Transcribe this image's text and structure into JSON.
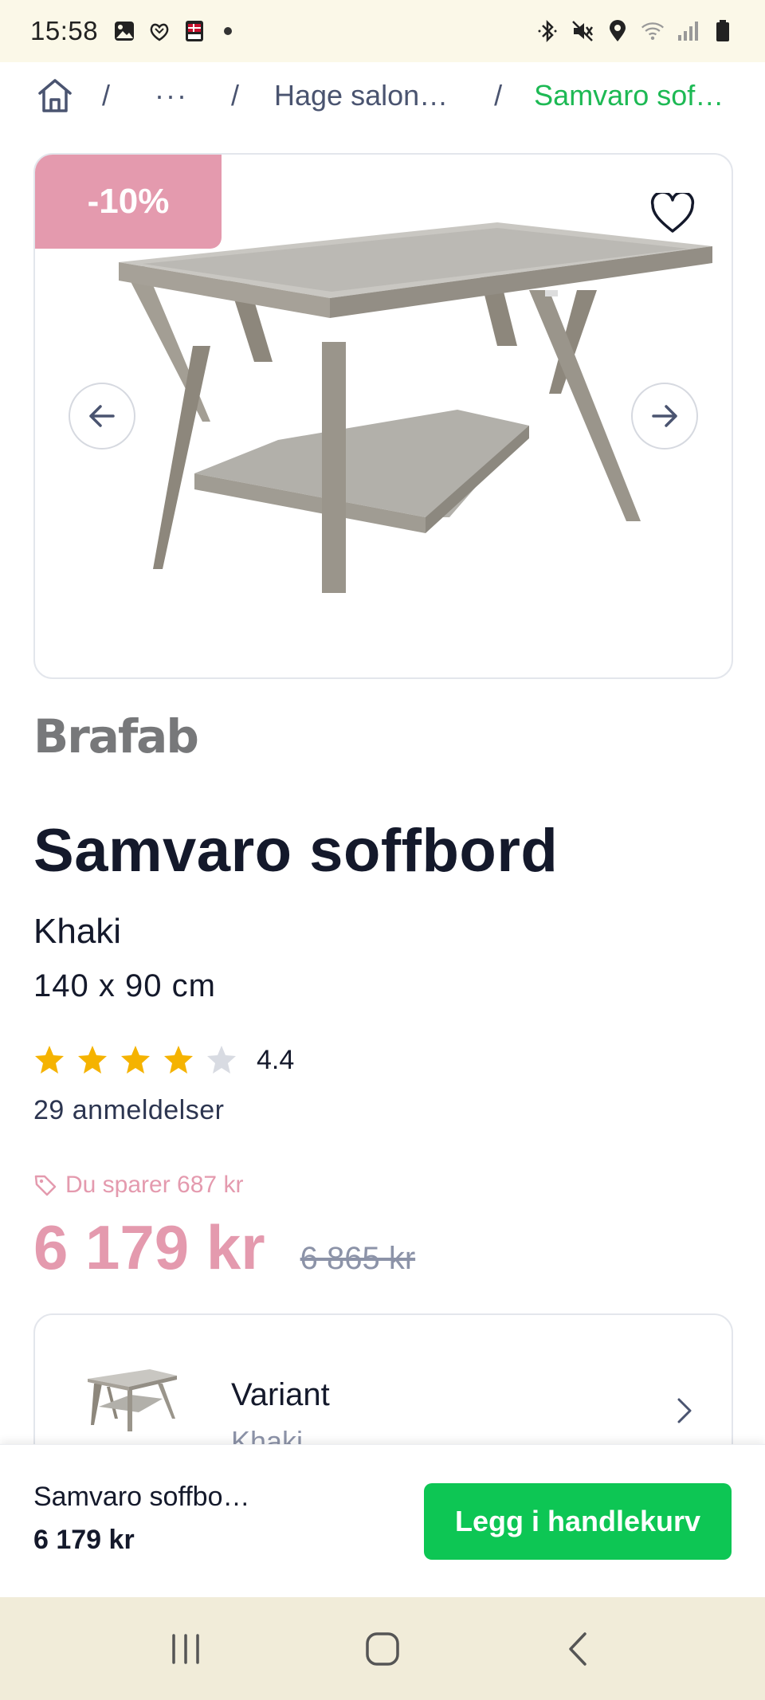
{
  "status_bar": {
    "time": "15:58",
    "left_icons": [
      "gallery-icon",
      "hands-icon",
      "flag-app-icon",
      "dot-icon"
    ],
    "right_icons": [
      "bluetooth-icon",
      "mute-icon",
      "location-icon",
      "wifi-icon",
      "signal-icon",
      "battery-icon"
    ]
  },
  "breadcrumb": {
    "home_icon": "home-icon",
    "separator": "/",
    "ellipsis": "···",
    "item": "Hage salon…",
    "current": "Samvaro sof…"
  },
  "product_image": {
    "discount_badge": "-10%",
    "favorite_icon": "heart-icon",
    "prev_icon": "arrow-left-icon",
    "next_icon": "arrow-right-icon"
  },
  "product": {
    "brand": "Brafab",
    "title": "Samvaro soffbord",
    "color": "Khaki",
    "size": "140 x 90 cm",
    "rating_value": "4.4",
    "rating": 4.4,
    "rating_max": 5,
    "reviews": "29 anmeldelser",
    "savings": "Du sparer 687 kr",
    "price": "6 179 kr",
    "old_price": "6 865 kr"
  },
  "variant": {
    "label": "Variant",
    "value": "Khaki"
  },
  "bottom_bar": {
    "name": "Samvaro soffbo…",
    "price": "6 179 kr",
    "add_to_cart": "Legg i handlekurv"
  },
  "nav_bar": {
    "buttons": [
      "recent-apps-icon",
      "home-circle-icon",
      "back-icon"
    ]
  },
  "colors": {
    "accent_green": "#0dc654",
    "sale_pink": "#e49aae",
    "star_gold": "#f5b301",
    "star_empty": "#d8dbe2"
  }
}
